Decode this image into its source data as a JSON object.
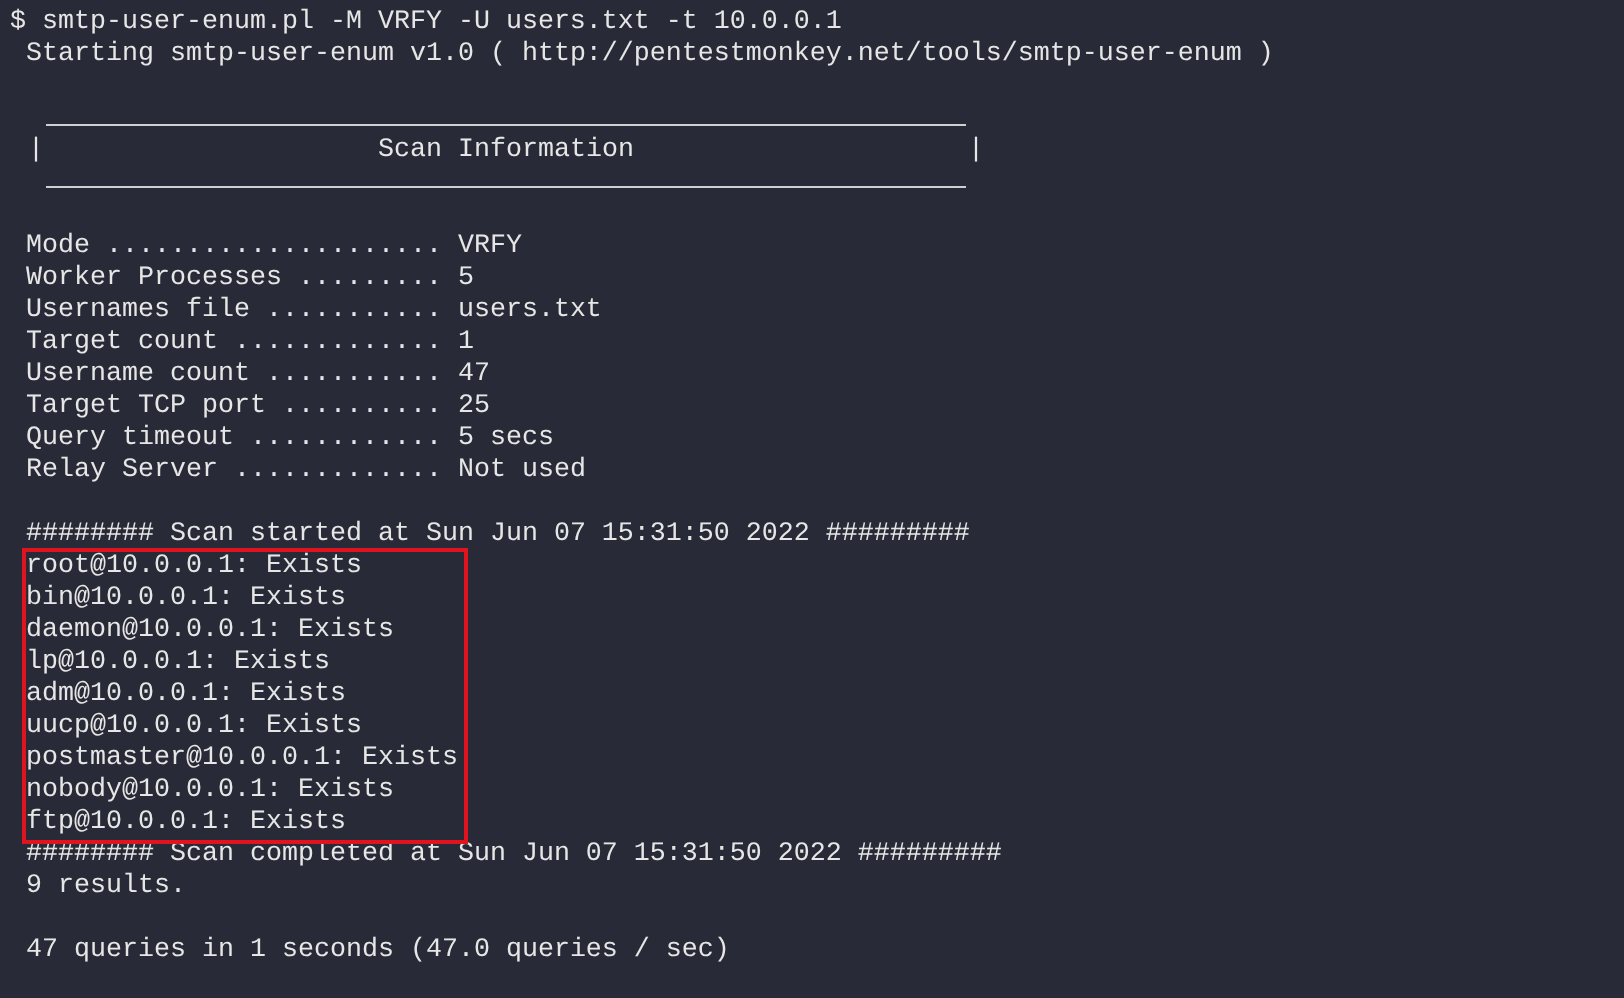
{
  "command": "$ smtp-user-enum.pl -M VRFY -U users.txt -t 10.0.0.1",
  "banner": "Starting smtp-user-enum v1.0 ( http://pentestmonkey.net/tools/smtp-user-enum )",
  "section_header": {
    "left_bar": "|",
    "title": "Scan Information",
    "right_bar": "|"
  },
  "settings": [
    "Mode ..................... VRFY",
    "Worker Processes ......... 5",
    "Usernames file ........... users.txt",
    "Target count ............. 1",
    "Username count ........... 47",
    "Target TCP port .......... 25",
    "Query timeout ............ 5 secs",
    "Relay Server ............. Not used"
  ],
  "scan_started": "######## Scan started at Sun Jun 07 15:31:50 2022 #########",
  "results": {
    "highlighted": true,
    "lines": [
      "root@10.0.0.1: Exists",
      "bin@10.0.0.1: Exists",
      "daemon@10.0.0.1: Exists",
      "lp@10.0.0.1: Exists",
      "adm@10.0.0.1: Exists",
      "uucp@10.0.0.1: Exists",
      "postmaster@10.0.0.1: Exists",
      "nobody@10.0.0.1: Exists",
      "ftp@10.0.0.1: Exists"
    ]
  },
  "scan_completed": "######## Scan completed at Sun Jun 07 15:31:50 2022 #########",
  "result_count": "9 results.",
  "summary": "47 queries in 1 seconds (47.0 queries / sec)"
}
